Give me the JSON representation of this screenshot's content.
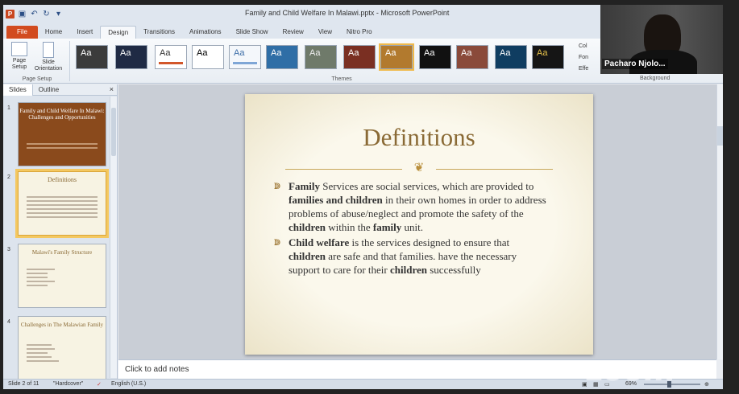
{
  "window": {
    "title": "Family and Child Welfare In Malawi.pptx - Microsoft PowerPoint"
  },
  "ribbon": {
    "tabs": [
      "File",
      "Home",
      "Insert",
      "Design",
      "Transitions",
      "Animations",
      "Slide Show",
      "Review",
      "View",
      "Nitro Pro"
    ],
    "active_tab": "Design",
    "page_setup": {
      "page_setup_label": "Page Setup",
      "slide_orientation_label": "Slide Orientation",
      "group_label": "Page Setup"
    },
    "themes_group_label": "Themes",
    "theme_sample": "Aa",
    "side_buttons": [
      "Col",
      "Fon",
      "Effe"
    ],
    "background_group_label": "Background"
  },
  "webcam": {
    "name": "Pacharo Njolo..."
  },
  "slides_pane": {
    "tabs": [
      "Slides",
      "Outline"
    ],
    "active_tab": "Slides",
    "thumbnails": [
      {
        "num": "1",
        "title": "Family and Child Welfare In Malawi: Challenges and Opportunities"
      },
      {
        "num": "2",
        "title": "Definitions"
      },
      {
        "num": "3",
        "title": "Malawi's Family Structure"
      },
      {
        "num": "4",
        "title": "Challenges in The Malawian Family"
      }
    ]
  },
  "slide": {
    "title": "Definitions",
    "bullet1": {
      "b1": "Family",
      "t1": " Services are social services, which are provided to ",
      "b2": "families and children",
      "t2": " in their own homes in order to address problems of abuse/neglect and promote the safety of the ",
      "b3": "children",
      "t3": " within the ",
      "b4": "family",
      "t4": " unit."
    },
    "bullet2": {
      "b1": "Child welfare",
      "t1": " is the services designed to ensure that ",
      "b2": "children",
      "t2": " are safe and that families. have the necessary support to care for their ",
      "b3": "children",
      "t3": " successfully"
    }
  },
  "notes": {
    "placeholder": "Click to add notes"
  },
  "statusbar": {
    "slide_info": "Slide 2 of 11",
    "theme": "\"Hardcover\"",
    "language": "English (U.S.)",
    "zoom": "69%"
  },
  "watermark": "zoom"
}
